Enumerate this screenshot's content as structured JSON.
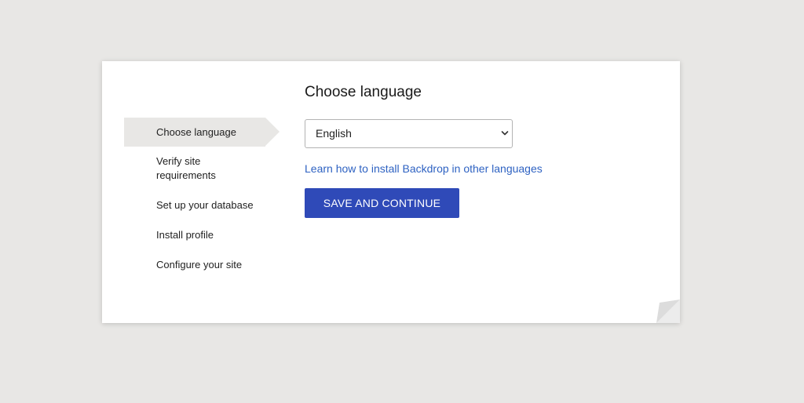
{
  "steps": {
    "items": [
      {
        "label": "Choose language",
        "active": true
      },
      {
        "label": "Verify site requirements",
        "active": false
      },
      {
        "label": "Set up your database",
        "active": false
      },
      {
        "label": "Install profile",
        "active": false
      },
      {
        "label": "Configure your site",
        "active": false
      }
    ]
  },
  "main": {
    "title": "Choose language",
    "language_select": {
      "value": "English"
    },
    "help_link": "Learn how to install Backdrop in other languages",
    "submit_label": "SAVE AND CONTINUE"
  },
  "colors": {
    "background": "#e8e7e5",
    "accent_button": "#2f4ab8",
    "link": "#2e62c2"
  },
  "icons": {
    "select_arrow": "chevron-down-icon",
    "page_corner": "page-curl-icon"
  }
}
